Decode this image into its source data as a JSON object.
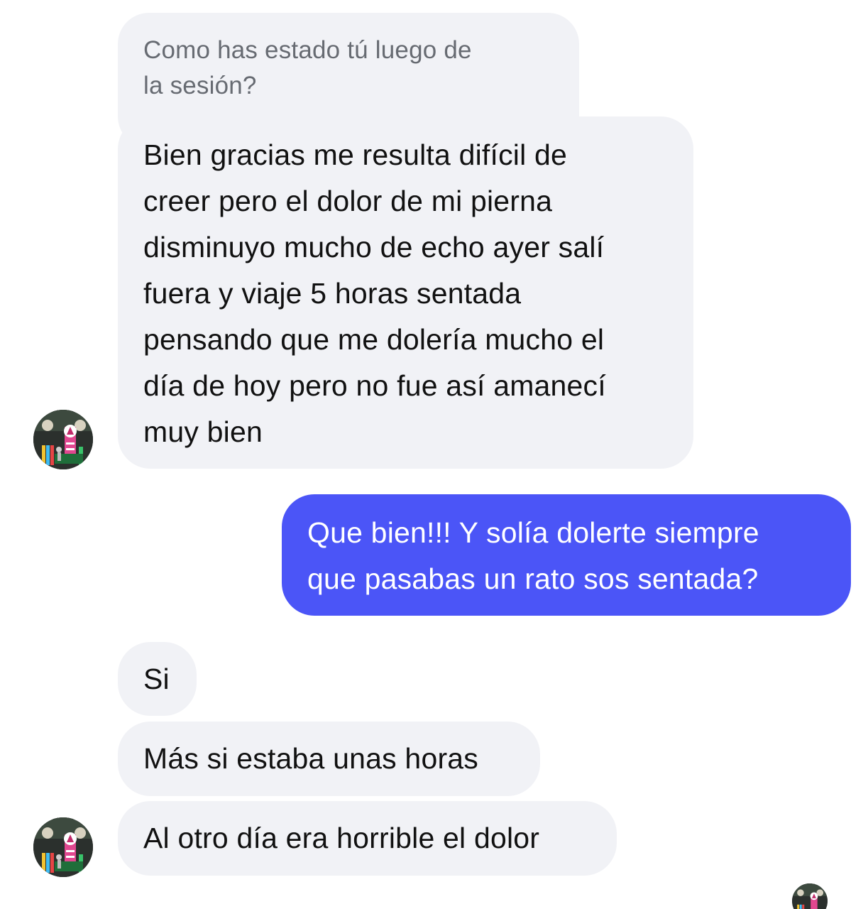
{
  "reply_preview": {
    "text": "Como has estado tú luego de\nla sesión?"
  },
  "messages": [
    {
      "direction": "incoming",
      "text": "Bien gracias me resulta difícil de\ncreer pero el dolor de mi pierna\ndisminuyo mucho de echo ayer salí\nfuera y viaje 5 horas sentada\npensando que me dolería mucho el\ndía de hoy pero no fue así amanecí\nmuy bien"
    },
    {
      "direction": "outgoing",
      "text": "Que bien!!! Y solía dolerte siempre\nque pasabas un rato sos sentada?"
    },
    {
      "direction": "incoming",
      "text": "Si"
    },
    {
      "direction": "incoming",
      "text": "Más si estaba unas horas"
    },
    {
      "direction": "incoming",
      "text": "Al otro día era horrible el dolor"
    }
  ],
  "colors": {
    "incoming_bubble": "#f1f2f6",
    "outgoing_bubble": "#4b55f7",
    "incoming_text": "#111111",
    "outgoing_text": "#ffffff",
    "reply_preview_text": "#676b72"
  },
  "icons": {
    "contact_avatar": "contact-avatar-photo",
    "read_receipt_avatar": "seen-avatar-photo"
  }
}
